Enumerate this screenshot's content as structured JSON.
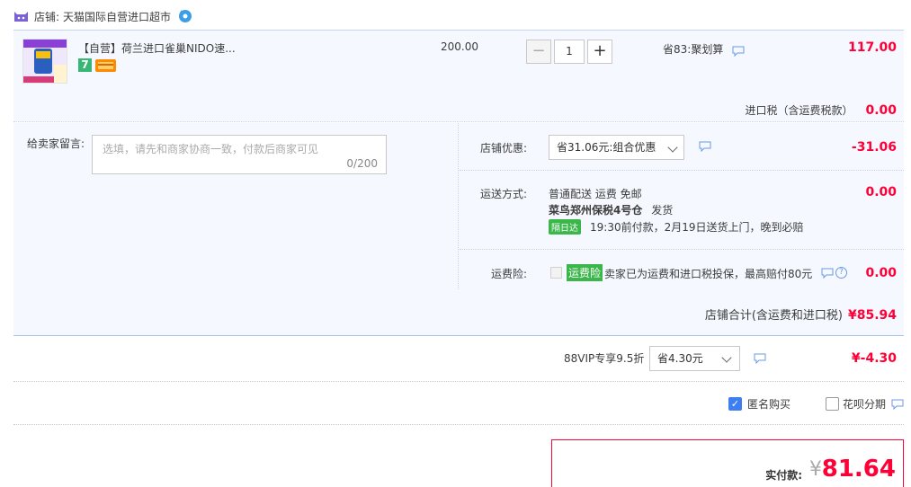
{
  "shop": {
    "label": "店铺:",
    "name": "天猫国际自营进口超市"
  },
  "item": {
    "title": "【自营】荷兰进口雀巢NIDO速...",
    "badge_seven": "7",
    "unit_price": "200.00",
    "quantity": "1",
    "minus": "−",
    "plus": "+",
    "promo": "省83:聚划算",
    "total": "117.00",
    "tax_label": "进口税（含运费税款）",
    "tax_value": "0.00"
  },
  "remark": {
    "label": "给卖家留言:",
    "placeholder": "选填，请先和商家协商一致，付款后商家可见",
    "count": "0/200"
  },
  "shop_discount": {
    "label": "店铺优惠:",
    "selected": "省31.06元:组合优惠",
    "value": "-31.06"
  },
  "shipping": {
    "label": "运送方式:",
    "line1": "普通配送 运费 免邮",
    "warehouse": "菜鸟郑州保税4号仓",
    "ship_word": "发货",
    "fast_badge": "隔日达",
    "eta": "19:30前付款，2月19日送货上门，晚到必赔",
    "value": "0.00"
  },
  "insurance": {
    "label": "运费险:",
    "badge": "运费险",
    "text": "卖家已为运费和进口税投保，最高赔付80元",
    "value": "0.00"
  },
  "shop_total": {
    "label": "店铺合计(含运费和进口税)",
    "value": "¥85.94"
  },
  "vip": {
    "label": "88VIP专享9.5折",
    "selected": "省4.30元",
    "value": "¥-4.30"
  },
  "options": {
    "anonymous": "匿名购买",
    "huabei": "花呗分期"
  },
  "payment": {
    "label": "实付款:",
    "currency": "¥",
    "amount": "81.64"
  },
  "colors": {
    "accent": "#ff0036",
    "blue_bg": "#f5f8ff",
    "green": "#3bb64a"
  }
}
